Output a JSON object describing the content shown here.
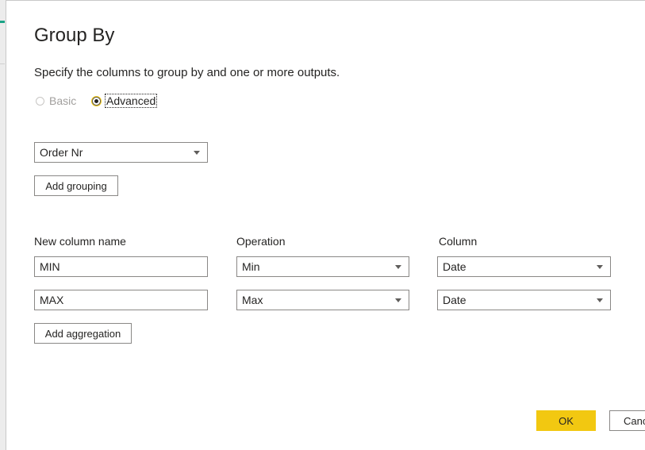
{
  "dialog": {
    "title": "Group By",
    "description": "Specify the columns to group by and one or more outputs."
  },
  "mode": {
    "basic_label": "Basic",
    "advanced_label": "Advanced",
    "selected": "Advanced"
  },
  "grouping": {
    "columns": [
      "Order Nr"
    ],
    "add_label": "Add grouping"
  },
  "aggregation": {
    "headers": {
      "new_column_name": "New column name",
      "operation": "Operation",
      "column": "Column"
    },
    "rows": [
      {
        "name": "MIN",
        "operation": "Min",
        "column": "Date"
      },
      {
        "name": "MAX",
        "operation": "Max",
        "column": "Date"
      }
    ],
    "add_label": "Add aggregation"
  },
  "footer": {
    "ok_label": "OK",
    "cancel_label": "Cancel"
  },
  "colors": {
    "accent": "#f2c811",
    "backdrop_accent": "#1aa386"
  }
}
